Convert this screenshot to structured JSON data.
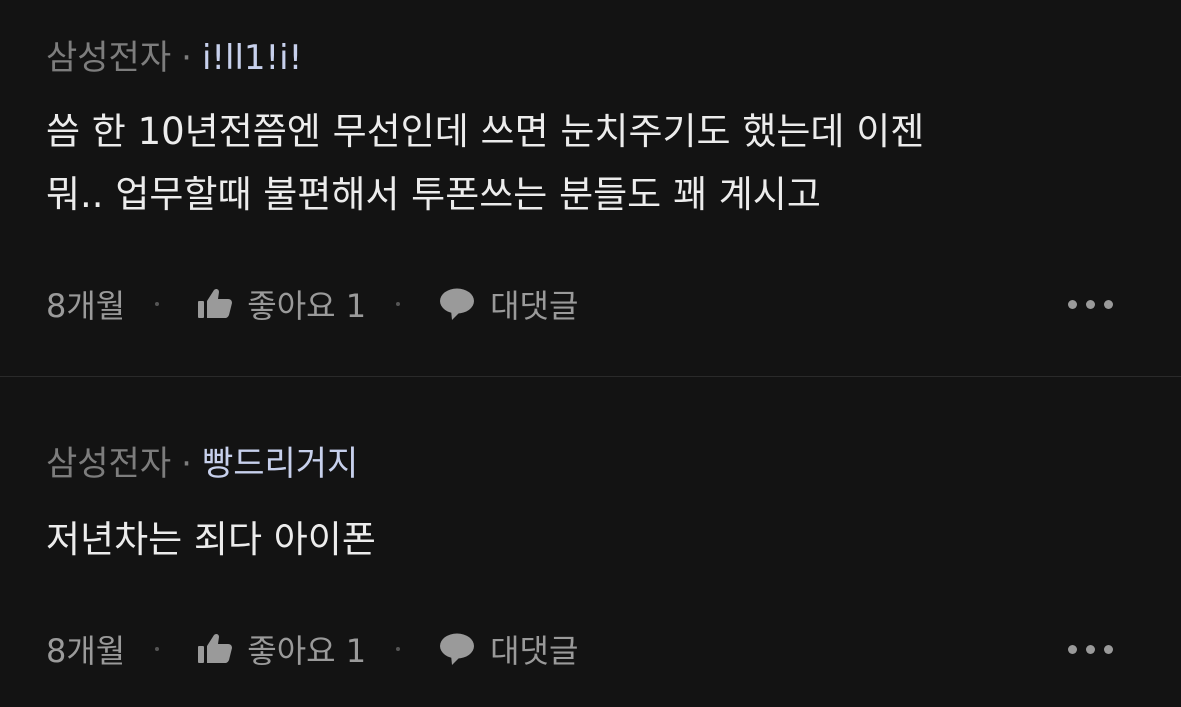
{
  "comments": [
    {
      "company": "삼성전자",
      "separator": "·",
      "nickname": "i!ll1!i!",
      "body_lines": [
        "씀 한 10년전쯤엔 무선인데 쓰면 눈치주기도 했는데 이젠",
        "뭐.. 업무할때 불편해서 투폰쓰는 분들도 꽤 계시고"
      ],
      "time": "8개월",
      "like_label": "좋아요 1",
      "reply_label": "대댓글"
    },
    {
      "company": "삼성전자",
      "separator": "·",
      "nickname": "빵드리거지",
      "body_lines": [
        "저년차는 죄다 아이폰"
      ],
      "time": "8개월",
      "like_label": "좋아요 1",
      "reply_label": "대댓글"
    }
  ],
  "icons": {
    "like": "thumbs-up-icon",
    "reply": "speech-bubble-icon",
    "more": "more-dots-icon"
  },
  "colors": {
    "background": "#131313",
    "nickname": "#c7d0ec",
    "meta_gray": "#7d7d7d",
    "action_gray": "#9a9a9a"
  }
}
